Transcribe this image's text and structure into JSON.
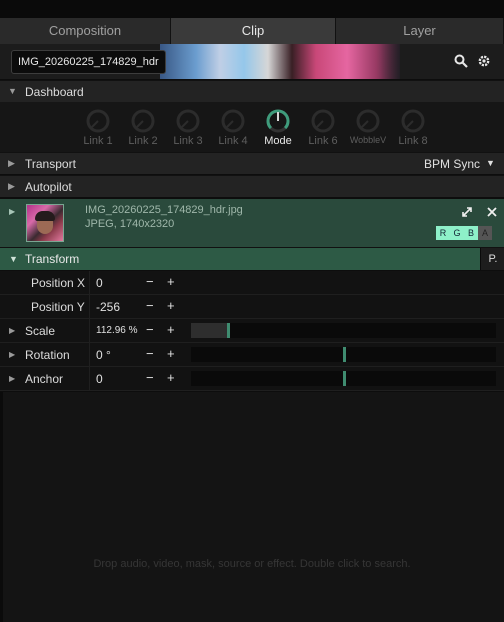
{
  "tabs": [
    "Composition",
    "Clip",
    "Layer"
  ],
  "active_tab": "Clip",
  "clip": {
    "name": "IMG_20260225_174829_hdr"
  },
  "dashboard": {
    "label": "Dashboard",
    "knobs": [
      "Link 1",
      "Link 2",
      "Link 3",
      "Link 4",
      "Mode",
      "Link 6",
      "WobbleV",
      "Link 8"
    ],
    "active_knob": "Mode"
  },
  "transport": {
    "label": "Transport",
    "sync": "BPM Sync"
  },
  "autopilot": {
    "label": "Autopilot"
  },
  "file": {
    "name": "IMG_20260225_174829_hdr.jpg",
    "info": "JPEG, 1740x2320",
    "channels": [
      "R",
      "G",
      "B",
      "A"
    ]
  },
  "transform": {
    "label": "Transform",
    "p_button": "P.",
    "params": [
      {
        "label": "Position X",
        "value": "0",
        "expandable": false
      },
      {
        "label": "Position Y",
        "value": "-256",
        "expandable": false
      },
      {
        "label": "Scale",
        "value": "112.96 %",
        "expandable": true,
        "level": 0.12
      },
      {
        "label": "Rotation",
        "value": "0 °",
        "expandable": true,
        "level": 0.5
      },
      {
        "label": "Anchor",
        "value": "0",
        "expandable": true,
        "level": 0.5
      }
    ],
    "minus": "−",
    "plus": "+"
  },
  "drop_hint": "Drop audio, video, mask, source or effect. Double click to search.",
  "colors": {
    "accent": "#2d5a45",
    "channel_on": "#8ef0c9"
  },
  "icons": {
    "search": "search-icon",
    "settings": "gear-icon",
    "expand": "expand-icon",
    "close": "close-icon"
  }
}
